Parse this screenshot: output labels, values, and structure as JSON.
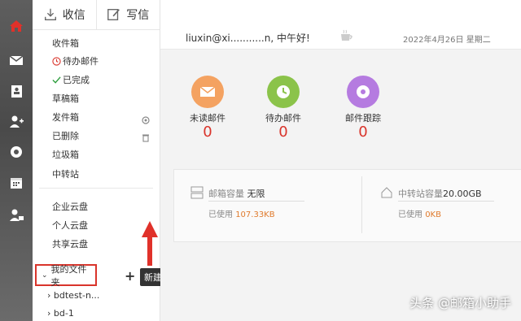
{
  "compose": {
    "receive_label": "收信",
    "write_label": "写信"
  },
  "folders": [
    {
      "label": "收件箱"
    },
    {
      "label": "待办邮件"
    },
    {
      "label": "已完成"
    },
    {
      "label": "草稿箱"
    },
    {
      "label": "发件箱"
    },
    {
      "label": "已删除"
    },
    {
      "label": "垃圾箱"
    },
    {
      "label": "中转站"
    }
  ],
  "cloud": [
    {
      "label": "企业云盘"
    },
    {
      "label": "个人云盘"
    },
    {
      "label": "共享云盘"
    }
  ],
  "my_folders": {
    "label": "我的文件夹",
    "new_folder_tooltip": "新建文件夹",
    "items": [
      {
        "label": "bdtest-n..."
      },
      {
        "label": "bd-1"
      }
    ]
  },
  "header": {
    "greeting": "liuxin@xi...........n, 中午好!",
    "date": "2022年4月26日 星期二"
  },
  "stats": [
    {
      "label": "未读邮件",
      "value": "0",
      "color": "#f4a261"
    },
    {
      "label": "待办邮件",
      "value": "0",
      "color": "#8bc34a"
    },
    {
      "label": "邮件跟踪",
      "value": "0",
      "color": "#b57be0"
    }
  ],
  "storage": {
    "mail_label": "邮箱容量",
    "mail_capacity": "无限",
    "mail_used_label": "已使用",
    "mail_used": "107.33KB",
    "transfer_label": "中转站容量",
    "transfer_capacity": "20.00GB",
    "transfer_used_label": "已使用",
    "transfer_used": "0KB"
  },
  "watermark": "头条 @邮箱小助手",
  "colors": {
    "accent": "#d9342b",
    "sidebar_dark": "#555555",
    "used_value": "#e07b2d"
  }
}
